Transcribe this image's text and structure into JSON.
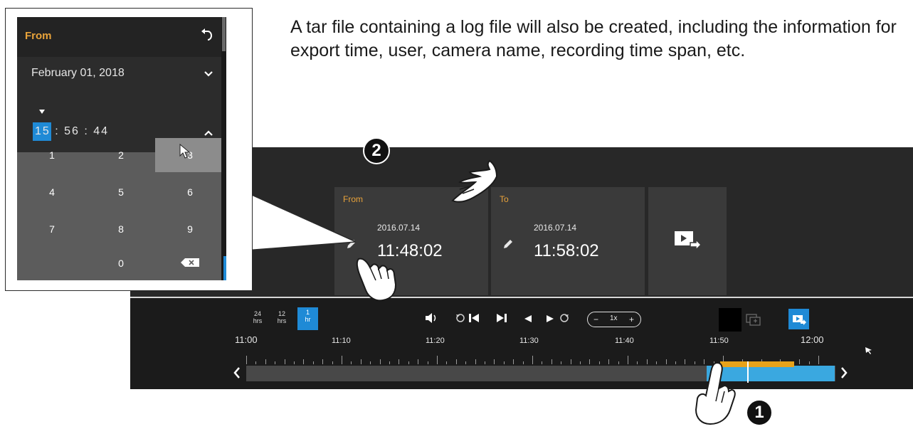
{
  "description": "A tar file containing a log file will also be created, including the information for export time, user, camera name, recording time span, etc.",
  "popup": {
    "label": "From",
    "date": "February 01, 2018",
    "time_hours": "15",
    "time_rest": ": 56 : 44",
    "keypad": [
      "1",
      "2",
      "3",
      "4",
      "5",
      "6",
      "7",
      "8",
      "9",
      "0"
    ],
    "pressed_key": "3",
    "icons": [
      "undo-icon",
      "chevron-down-icon",
      "chevron-up-icon",
      "backspace-icon"
    ]
  },
  "from_card": {
    "label": "From",
    "date": "2016.07.14",
    "time": "11:48:02"
  },
  "to_card": {
    "label": "To",
    "date": "2016.07.14",
    "time": "11:58:02"
  },
  "range_buttons": [
    {
      "value": "24",
      "unit": "hrs"
    },
    {
      "value": "12",
      "unit": "hrs"
    },
    {
      "value": "1",
      "unit": "hr",
      "selected": true
    }
  ],
  "speed": {
    "minus": "−",
    "value": "1x",
    "plus": "+"
  },
  "timeline": {
    "start": "11:00",
    "end": "12:00",
    "ticks": [
      "11:10",
      "11:20",
      "11:30",
      "11:40",
      "11:50"
    ]
  },
  "markers": {
    "one": "1",
    "two": "2"
  },
  "colors": {
    "accent_blue": "#1f8ad6",
    "label_orange": "#e9a33a",
    "range_orange": "#e7a21a"
  }
}
